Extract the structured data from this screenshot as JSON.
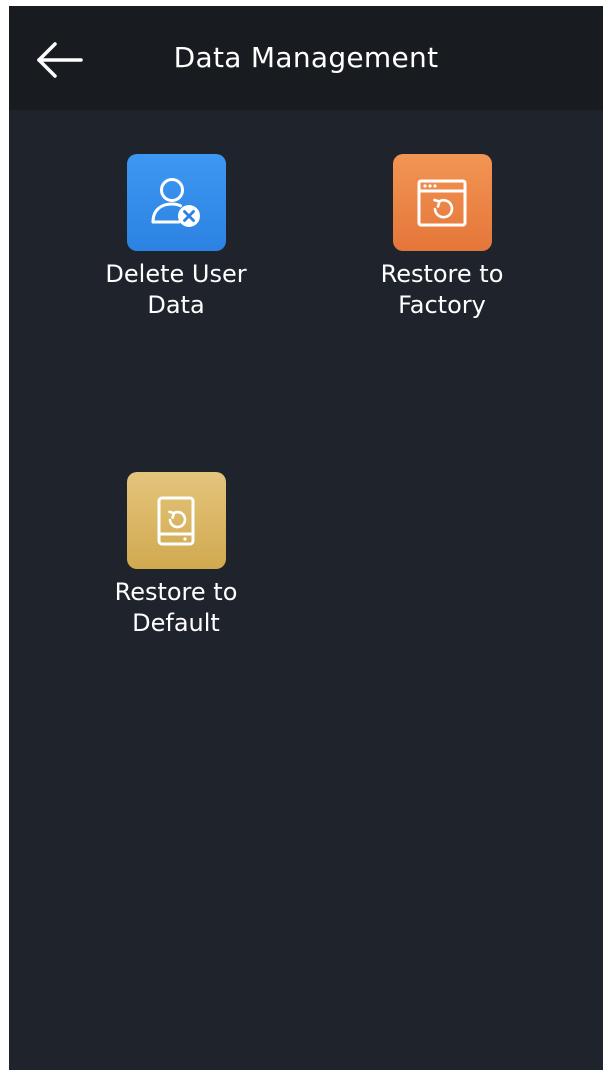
{
  "header": {
    "title": "Data Management",
    "back_icon": "arrow-left-icon"
  },
  "tiles": [
    {
      "id": "delete-user-data",
      "label_lines": [
        "Delete User",
        "Data"
      ],
      "icon": "user-remove-icon",
      "color": "#3b93ee"
    },
    {
      "id": "restore-to-factory",
      "label_lines": [
        "Restore to",
        "Factory"
      ],
      "icon": "window-restore-icon",
      "color": "#ed8646"
    },
    {
      "id": "restore-to-default",
      "label_lines": [
        "Restore to",
        "Default"
      ],
      "icon": "device-restore-icon",
      "color": "#dcb965"
    }
  ],
  "colors": {
    "background": "#1f242c",
    "header_background": "#181b20",
    "text": "#ffffff"
  }
}
